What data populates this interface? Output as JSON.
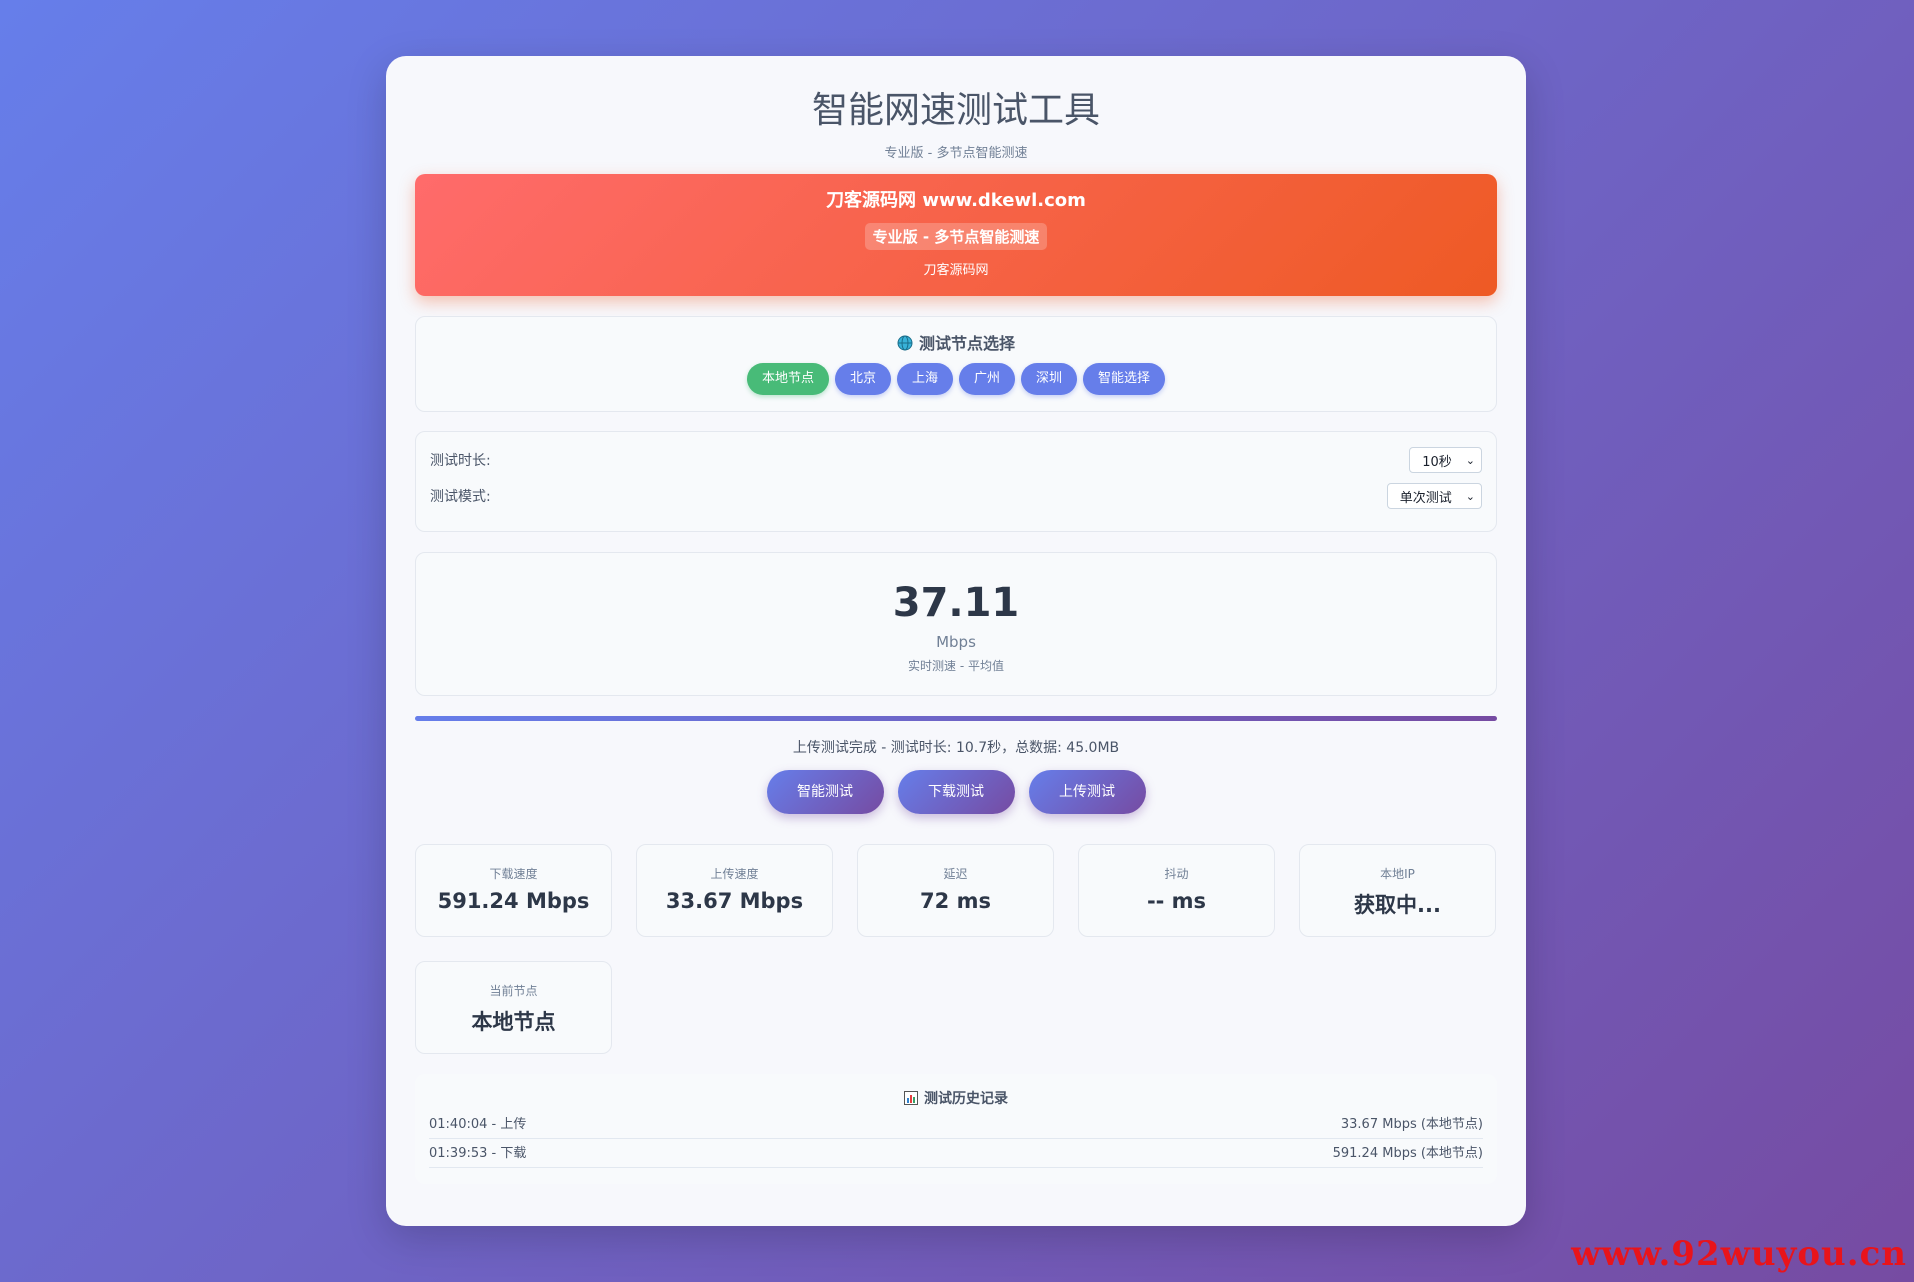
{
  "header": {
    "title": "智能网速测试工具",
    "subtitle": "专业版 - 多节点智能测速"
  },
  "banner": {
    "title": "刀客源码网 www.dkewl.com",
    "badge": "专业版 - 多节点智能测速",
    "note": "刀客源码网"
  },
  "nodes": {
    "heading": "测试节点选择",
    "items": [
      "本地节点",
      "北京",
      "上海",
      "广州",
      "深圳",
      "智能选择"
    ],
    "active": "本地节点"
  },
  "settings": {
    "duration_label": "测试时长:",
    "duration_value": "10秒",
    "mode_label": "测试模式:",
    "mode_value": "单次测试"
  },
  "speed": {
    "value": "37.11",
    "unit": "Mbps",
    "note": "实时测速 - 平均值"
  },
  "progress": {
    "percent": 100
  },
  "status": "上传测试完成 - 测试时长: 10.7秒，总数据: 45.0MB",
  "actions": [
    "智能测试",
    "下载测试",
    "上传测试"
  ],
  "stats": [
    {
      "label": "下载速度",
      "value": "591.24 Mbps"
    },
    {
      "label": "上传速度",
      "value": "33.67 Mbps"
    },
    {
      "label": "延迟",
      "value": "72 ms"
    },
    {
      "label": "抖动",
      "value": "-- ms"
    },
    {
      "label": "本地IP",
      "value": "获取中..."
    },
    {
      "label": "当前节点",
      "value": "本地节点"
    }
  ],
  "history": {
    "heading": "测试历史记录",
    "rows": [
      {
        "left": "01:40:04 - 上传",
        "right": "33.67 Mbps (本地节点)"
      },
      {
        "left": "01:39:53 - 下载",
        "right": "591.24 Mbps (本地节点)"
      }
    ]
  },
  "watermark": "www.92wuyou.cn",
  "colors": {
    "accent": "#667eea",
    "accent_end": "#764ba2",
    "active_node": "#48bb78",
    "banner_start": "#ff6b6b",
    "banner_end": "#ee5a24",
    "watermark": "#e8141b"
  },
  "icons": {
    "nodes_heading": "globe-icon",
    "history_heading": "bar-chart-icon",
    "select": "chevron-down-icon"
  }
}
